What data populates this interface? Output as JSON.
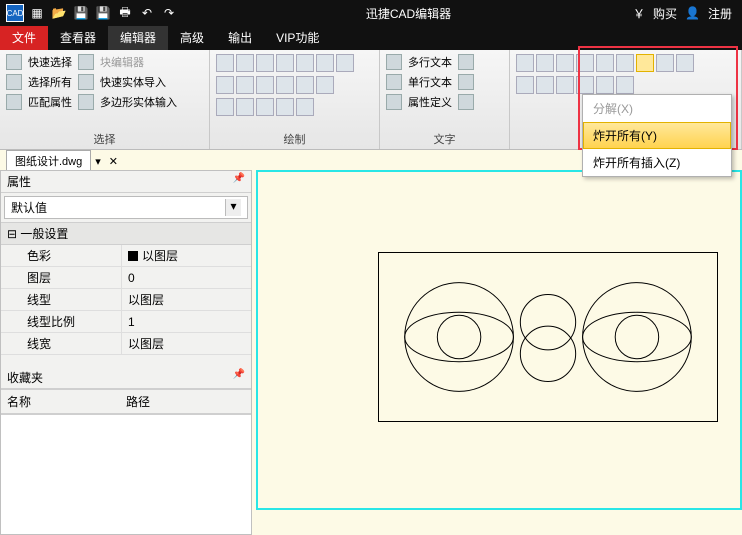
{
  "titlebar": {
    "title": "迅捷CAD编辑器",
    "buy": "购买",
    "register": "注册"
  },
  "menubar": {
    "tabs": [
      "文件",
      "查看器",
      "编辑器",
      "高级",
      "输出",
      "VIP功能"
    ],
    "active": 2
  },
  "ribbon_panels": {
    "select": {
      "quick_select": "快速选择",
      "block_editor": "块编辑器",
      "select_all": "选择所有",
      "quick_solid_import": "快速实体导入",
      "match_props": "匹配属性",
      "poly_solid_input": "多边形实体输入",
      "label": "选择"
    },
    "draw": {
      "label": "绘制"
    },
    "text": {
      "mline_text": "多行文本",
      "sline_text": "单行文本",
      "attr_def": "属性定义",
      "label": "文字"
    }
  },
  "dropdown": {
    "items": [
      {
        "label": "分解(X)",
        "disabled": true
      },
      {
        "label": "炸开所有(Y)",
        "hover": true
      },
      {
        "label": "炸开所有插入(Z)"
      }
    ]
  },
  "filetab": {
    "name": "图纸设计.dwg"
  },
  "props_panel": {
    "title": "属性",
    "default_select": "默认值",
    "category": "一般设置",
    "rows": {
      "color": {
        "k": "色彩",
        "v": "以图层"
      },
      "layer": {
        "k": "图层",
        "v": "0"
      },
      "linetype": {
        "k": "线型",
        "v": "以图层"
      },
      "ltscale": {
        "k": "线型比例",
        "v": "1"
      },
      "lineweight": {
        "k": "线宽",
        "v": "以图层"
      }
    }
  },
  "favorites": {
    "title": "收藏夹",
    "col_name": "名称",
    "col_path": "路径"
  }
}
